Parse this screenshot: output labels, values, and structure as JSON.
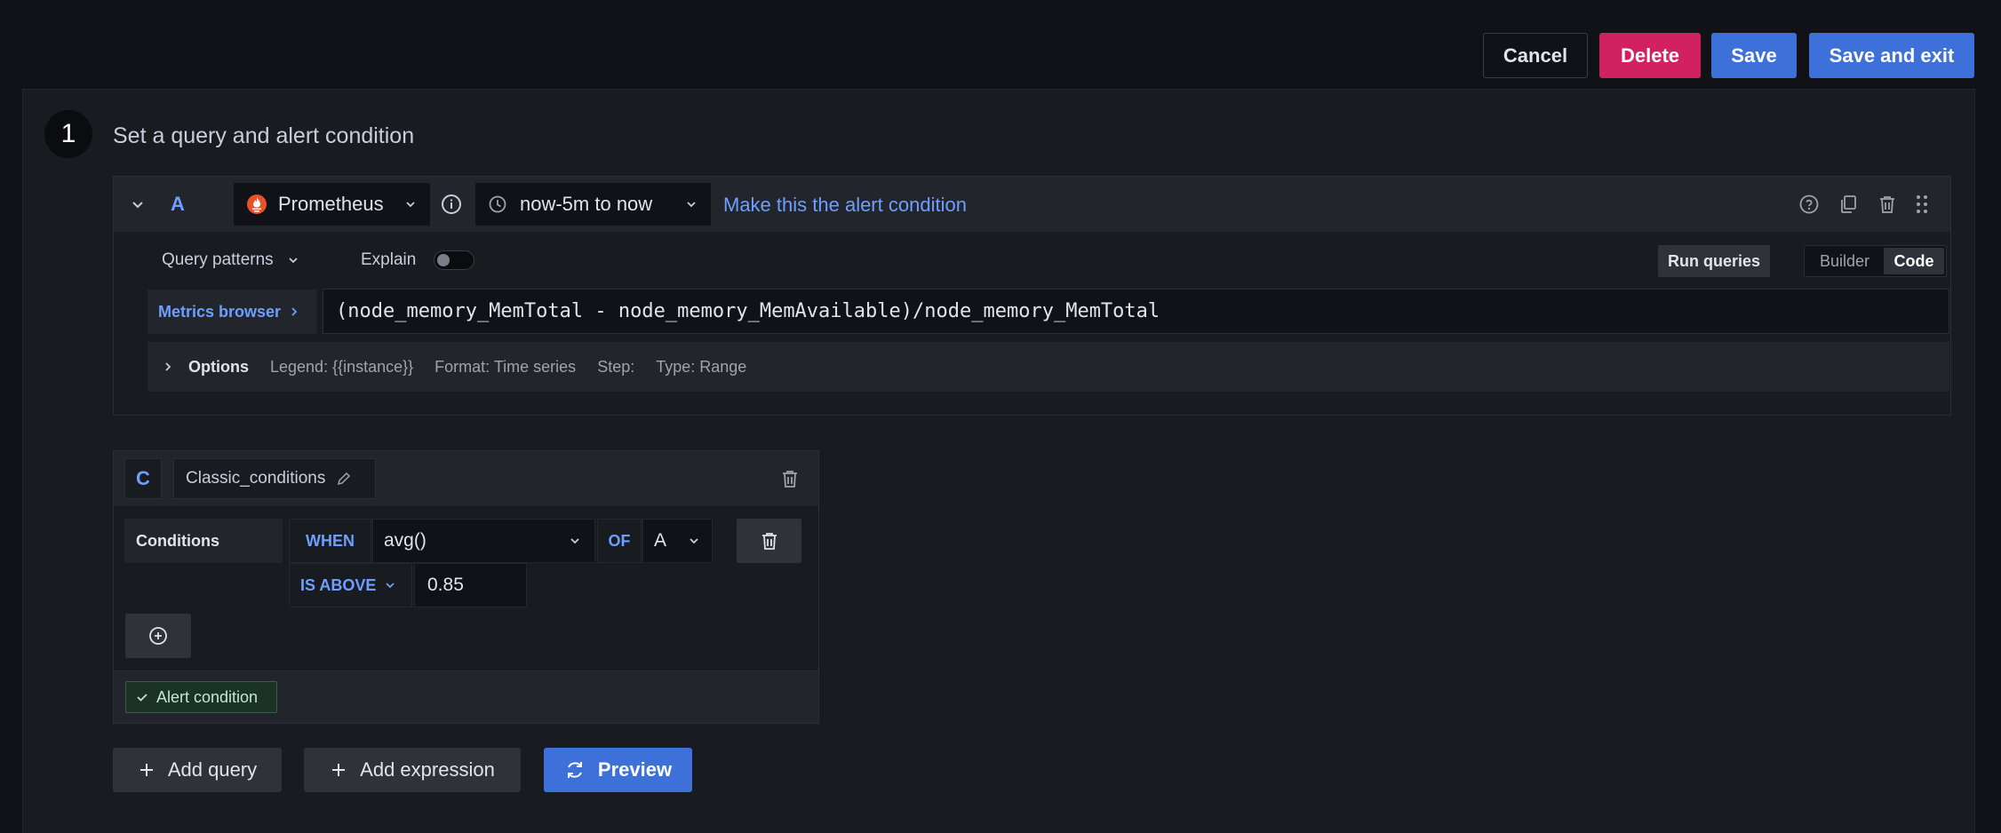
{
  "toolbar": {
    "cancel": "Cancel",
    "delete": "Delete",
    "save": "Save",
    "save_exit": "Save and exit"
  },
  "step": {
    "number": "1",
    "title": "Set a query and alert condition"
  },
  "query_a": {
    "letter": "A",
    "datasource": "Prometheus",
    "time_range": "now-5m to now",
    "make_condition": "Make this the alert condition",
    "query_patterns": "Query patterns",
    "explain": "Explain",
    "run_queries": "Run queries",
    "mode_builder": "Builder",
    "mode_code": "Code",
    "metrics_browser": "Metrics browser",
    "expression": "(node_memory_MemTotal - node_memory_MemAvailable)/node_memory_MemTotal",
    "options": {
      "title": "Options",
      "legend": "Legend: {{instance}}",
      "format": "Format: Time series",
      "step": "Step:",
      "type": "Type: Range"
    }
  },
  "expression_c": {
    "letter": "C",
    "name": "Classic_conditions",
    "conditions_label": "Conditions",
    "when": "WHEN",
    "reducer": "avg()",
    "of": "OF",
    "query_ref": "A",
    "evaluator": "IS ABOVE",
    "threshold": "0.85",
    "alert_badge": "Alert condition"
  },
  "actions": {
    "add_query": "Add query",
    "add_expression": "Add expression",
    "preview": "Preview"
  },
  "colors": {
    "background": "#111217",
    "panel": "#181b1f",
    "primary": "#3d71d9",
    "destructive": "#d1215e",
    "link": "#6e9fff",
    "success_badge": "#1a3324"
  }
}
